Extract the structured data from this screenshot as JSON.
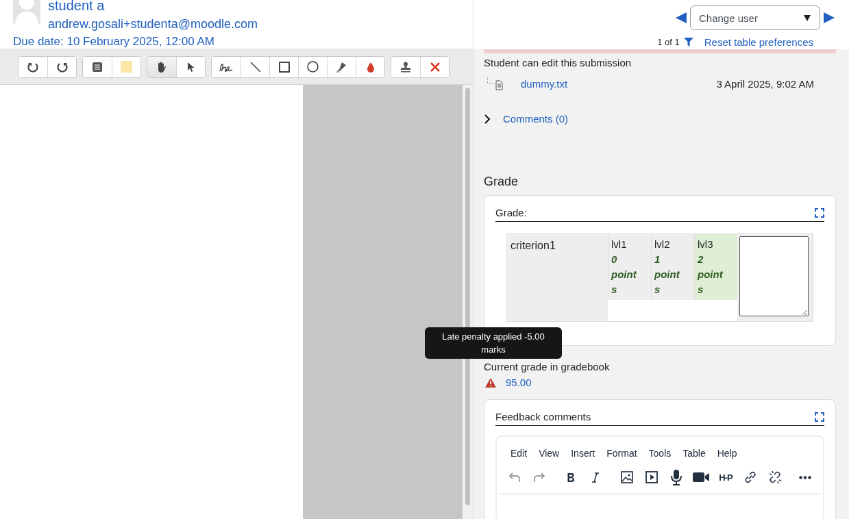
{
  "student": {
    "name": "student a",
    "email": "andrew.gosali+studenta@moodle.com",
    "due_date": "Due date: 10 February 2025, 12:00 AM"
  },
  "annotation_toolbar": {
    "groups": [
      [
        {
          "kind": "rotate-left",
          "selected": false
        },
        {
          "kind": "rotate-right",
          "selected": false
        }
      ],
      [
        {
          "kind": "comment",
          "selected": false
        },
        {
          "kind": "swatch",
          "selected": false
        }
      ],
      [
        {
          "kind": "hand",
          "selected": true
        },
        {
          "kind": "pointer",
          "selected": false
        }
      ],
      [
        {
          "kind": "pen",
          "selected": false
        },
        {
          "kind": "line",
          "selected": false
        },
        {
          "kind": "rectangle",
          "selected": false
        },
        {
          "kind": "oval",
          "selected": false
        },
        {
          "kind": "highlighter",
          "selected": false
        },
        {
          "kind": "drop",
          "selected": false
        }
      ],
      [
        {
          "kind": "stamp",
          "selected": false
        },
        {
          "kind": "delete",
          "selected": false
        }
      ]
    ]
  },
  "user_nav": {
    "select": "Change user",
    "count": "1 of 1",
    "reset_link": "Reset table preferences"
  },
  "submission": {
    "status": "Student can edit this submission",
    "file": {
      "name": "dummy.txt",
      "date": "3 April 2025, 9:02 AM"
    },
    "comments": {
      "label": "Comments (0)",
      "expanded": false
    }
  },
  "grade": {
    "heading": "Grade",
    "panel_label": "Grade:",
    "rubric": {
      "criterion": "criterion1",
      "levels": [
        {
          "name": "lvl1",
          "points": "0 points",
          "selected": false
        },
        {
          "name": "lvl2",
          "points": "1 points",
          "selected": false
        },
        {
          "name": "lvl3",
          "points": "2 points",
          "selected": true
        }
      ]
    },
    "current_label": "Current grade in gradebook",
    "current_value": "95.00",
    "tooltip": "Late penalty applied -5.00 marks"
  },
  "feedback": {
    "label": "Feedback comments",
    "menu": [
      "Edit",
      "View",
      "Insert",
      "Format",
      "Tools",
      "Table",
      "Help"
    ],
    "tools": [
      {
        "kind": "undo",
        "disabled": true
      },
      {
        "kind": "redo",
        "disabled": true
      },
      {
        "kind": "bold",
        "disabled": false
      },
      {
        "kind": "italic",
        "disabled": false
      },
      {
        "kind": "image",
        "disabled": false
      },
      {
        "kind": "media",
        "disabled": false
      },
      {
        "kind": "mic",
        "disabled": false
      },
      {
        "kind": "video",
        "disabled": false
      },
      {
        "kind": "h5p",
        "text": "H-P",
        "disabled": false
      },
      {
        "kind": "link",
        "disabled": false
      },
      {
        "kind": "unlink",
        "disabled": false
      },
      {
        "kind": "more",
        "disabled": false
      }
    ]
  }
}
